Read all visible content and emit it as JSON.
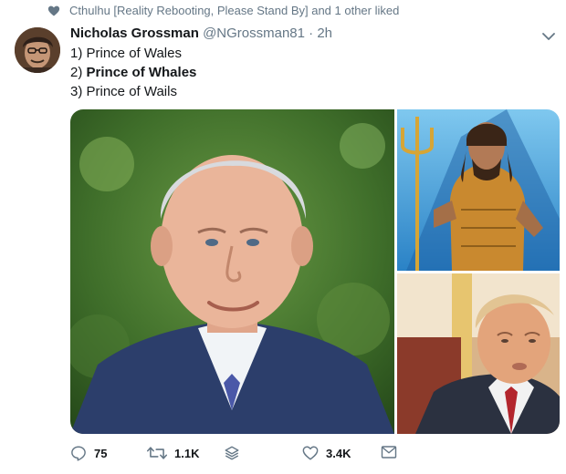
{
  "social_context": {
    "icon": "heart-icon",
    "text": "Cthulhu [Reality Rebooting, Please Stand By] and 1 other liked"
  },
  "author": {
    "display_name": "Nicholas Grossman",
    "handle": "@NGrossman81",
    "separator": "·",
    "time": "2h"
  },
  "tweet": {
    "lines": [
      {
        "text": "1) Prince of Wales",
        "bold": false
      },
      {
        "prefix": "2) ",
        "emphasis": "Prince of Whales",
        "bold": true
      },
      {
        "text": "3) Prince of Wails",
        "bold": false
      }
    ]
  },
  "media": {
    "images": [
      {
        "name": "man-in-suit-photo",
        "position": "left"
      },
      {
        "name": "armored-hero-with-trident-photo",
        "position": "top-right"
      },
      {
        "name": "man-with-red-tie-photo",
        "position": "bottom-right"
      }
    ]
  },
  "actions": {
    "reply": {
      "icon": "reply-icon",
      "count": "75"
    },
    "retweet": {
      "icon": "retweet-icon",
      "count": "1.1K"
    },
    "stack": {
      "icon": "stack-icon"
    },
    "like": {
      "icon": "heart-outline-icon",
      "count": "3.4K"
    },
    "message": {
      "icon": "envelope-icon"
    }
  },
  "colors": {
    "secondary_text": "#657786",
    "primary_text": "#14171a",
    "background": "#ffffff"
  }
}
